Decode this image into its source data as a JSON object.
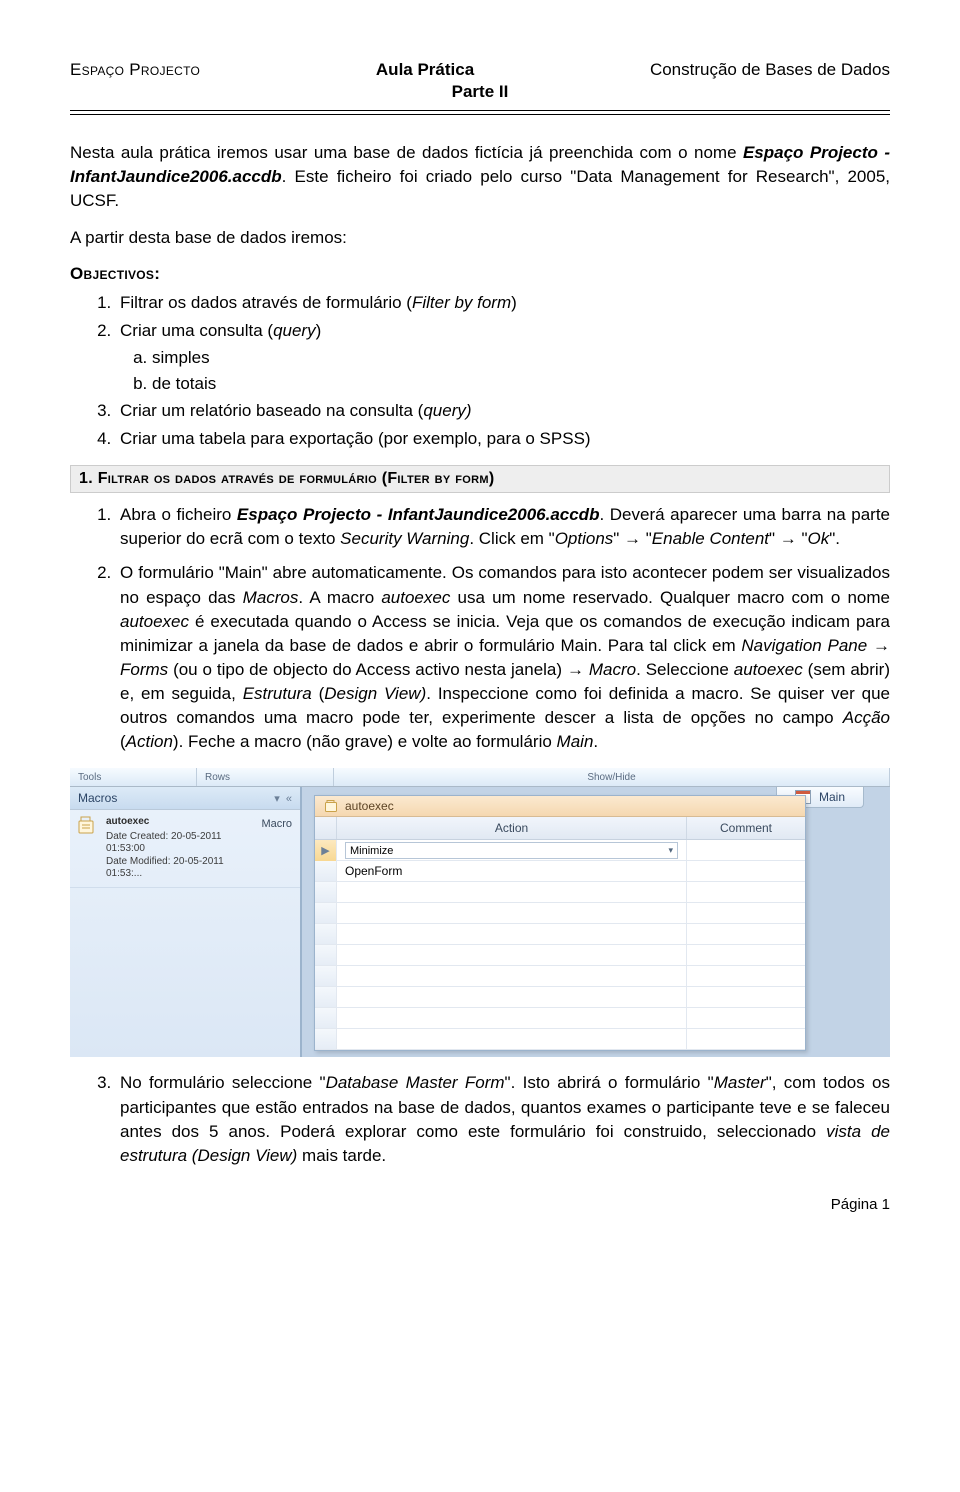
{
  "header": {
    "left": "Espaço Projecto",
    "centerLine1": "Aula Prática",
    "centerLine2": "Parte II",
    "right": "Construção de Bases de Dados"
  },
  "intro": {
    "p1_before": "Nesta aula prática iremos usar uma base de dados fictícia já preenchida com o nome ",
    "p1_em": "Espaço Projecto - InfantJaundice2006.accdb",
    "p1_after": ". Este ficheiro foi criado pelo curso \"Data Management for Research\", 2005, UCSF.",
    "p2": "A partir desta base de dados iremos:"
  },
  "objectivesHeading": "Objectivos:",
  "objectives": {
    "o1_a": "Filtrar os dados através de formulário (",
    "o1_em": "Filter by form",
    "o1_b": ")",
    "o2_a": "Criar uma consulta (",
    "o2_em": "query",
    "o2_b": ")",
    "o2_sub_a": "simples",
    "o2_sub_b": "de totais",
    "o3_a": "Criar um relatório baseado na consulta (",
    "o3_em": "query)",
    "o4": "Criar uma tabela para exportação (por exemplo, para o SPSS)"
  },
  "sectionTitle": "1. Filtrar os dados através de formulário (Filter by form)",
  "steps": {
    "s1_a": "Abra o ficheiro ",
    "s1_em1": "Espaço Projecto - InfantJaundice2006.accdb",
    "s1_b": ". Deverá aparecer uma barra na parte superior do ecrã com o texto ",
    "s1_em2": "Security Warning",
    "s1_c": ". Click em \"",
    "s1_em3": "Options",
    "s1_d": "\" → \"",
    "s1_em4": "Enable Content",
    "s1_e": "\" → \"",
    "s1_em5": "Ok",
    "s1_f": "\".",
    "s2_a": "O formulário \"Main\" abre automaticamente. Os comandos para isto acontecer podem ser visualizados no espaço das ",
    "s2_em1": "Macros",
    "s2_b": ". A macro ",
    "s2_em2": "autoexec",
    "s2_c": " usa um nome reservado. Qualquer macro com o nome ",
    "s2_em3": "autoexec",
    "s2_d": " é executada quando o Access se inicia. Veja que os comandos de execução indicam para minimizar a janela da base de dados e abrir o formulário Main. Para tal click em ",
    "s2_em4": "Navigation Pane",
    "s2_e": " → ",
    "s2_em5": "Forms",
    "s2_f": " (ou o tipo de objecto do Access activo nesta janela) → ",
    "s2_em6": "Macro",
    "s2_g": ". Seleccione ",
    "s2_em7": "autoexec",
    "s2_h": " (sem abrir) e, em seguida, ",
    "s2_em8": "Estrutura",
    "s2_i": " (",
    "s2_em9": "Design View)",
    "s2_j": ". Inspeccione como foi definida a macro. Se quiser ver que outros comandos uma macro pode ter, experimente descer a lista de opções no campo ",
    "s2_em10": "Acção",
    "s2_k": " (",
    "s2_em11": "Action",
    "s2_l": "). Feche a macro (não grave) e volte ao formulário ",
    "s2_em12": "Main",
    "s2_m": ".",
    "s3_a": "No formulário seleccione \"",
    "s3_em1": "Database Master Form",
    "s3_b": "\". Isto abrirá o formulário \"",
    "s3_em2": "Master",
    "s3_c": "\", com todos os participantes que estão entrados na base de dados, quantos exames o participante teve e se faleceu antes dos 5 anos. Poderá explorar como este formulário foi construido, seleccionado ",
    "s3_em3": "vista de estrutura (Design View)",
    "s3_d": " mais tarde."
  },
  "screenshot": {
    "stripLabels": {
      "tools": "Tools",
      "rows": "Rows",
      "showhide": "Show/Hide"
    },
    "nav": {
      "category": "Macros",
      "type": "Macro",
      "itemTitle": "autoexec",
      "dateCreated": "Date Created: 20-05-2011 01:53:00",
      "dateModified": "Date Modified: 20-05-2011 01:53:..."
    },
    "mainTab": "Main",
    "designTab": "autoexec",
    "columns": {
      "action": "Action",
      "comment": "Comment"
    },
    "rows": {
      "r1": "Minimize",
      "r2": "OpenForm"
    }
  },
  "footer": "Página 1"
}
